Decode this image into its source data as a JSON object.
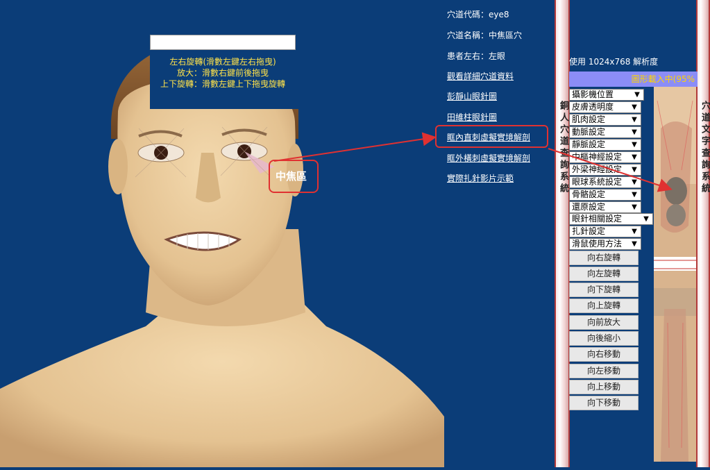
{
  "overlay": {
    "input_value": "",
    "help": [
      "左右旋轉(滑數左鍵左右拖曳)",
      "放大：滑數右鍵前後拖曳",
      "上下旋轉：滑數左鍵上下拖曳旋轉"
    ]
  },
  "info": {
    "code": "穴道代碼：eye8",
    "name": "穴道名稱：中焦區穴",
    "side": "患者左右：左眼",
    "links": [
      "觀看詳細穴道資料",
      "彭靜山眼針圖",
      "田維柱眼針圖",
      "眶內直刺虛擬實境解剖",
      "眶外橫刺虛擬實境解剖",
      "實際扎針影片示範"
    ]
  },
  "callout": {
    "label": "中焦區"
  },
  "left_bar_title": "銅人穴道查詢系統",
  "right_bar_title": "穴道文字查詢系統",
  "resolution_text": "使用 1024x768 解析度",
  "loading_text": "圖形載入中(95%",
  "selects": [
    "攝影機位置",
    "皮膚透明度",
    "肌肉設定",
    "動脈設定",
    "靜脈設定",
    "中樞神經設定",
    "外梁神經設定",
    "眼球系統設定",
    "骨骼設定",
    "還原設定",
    "眼針相關設定",
    "扎針設定",
    "滑鼠使用方法"
  ],
  "buttons": [
    "向右旋轉",
    "向左旋轉",
    "向下旋轉",
    "向上旋轉",
    "向前放大",
    "向後縮小",
    "向右移動",
    "向左移動",
    "向上移動",
    "向下移動"
  ],
  "colors": {
    "background": "#0b3d78",
    "highlight": "#e03131",
    "help_text": "#ffe24a",
    "skin": "#e8c99a"
  }
}
